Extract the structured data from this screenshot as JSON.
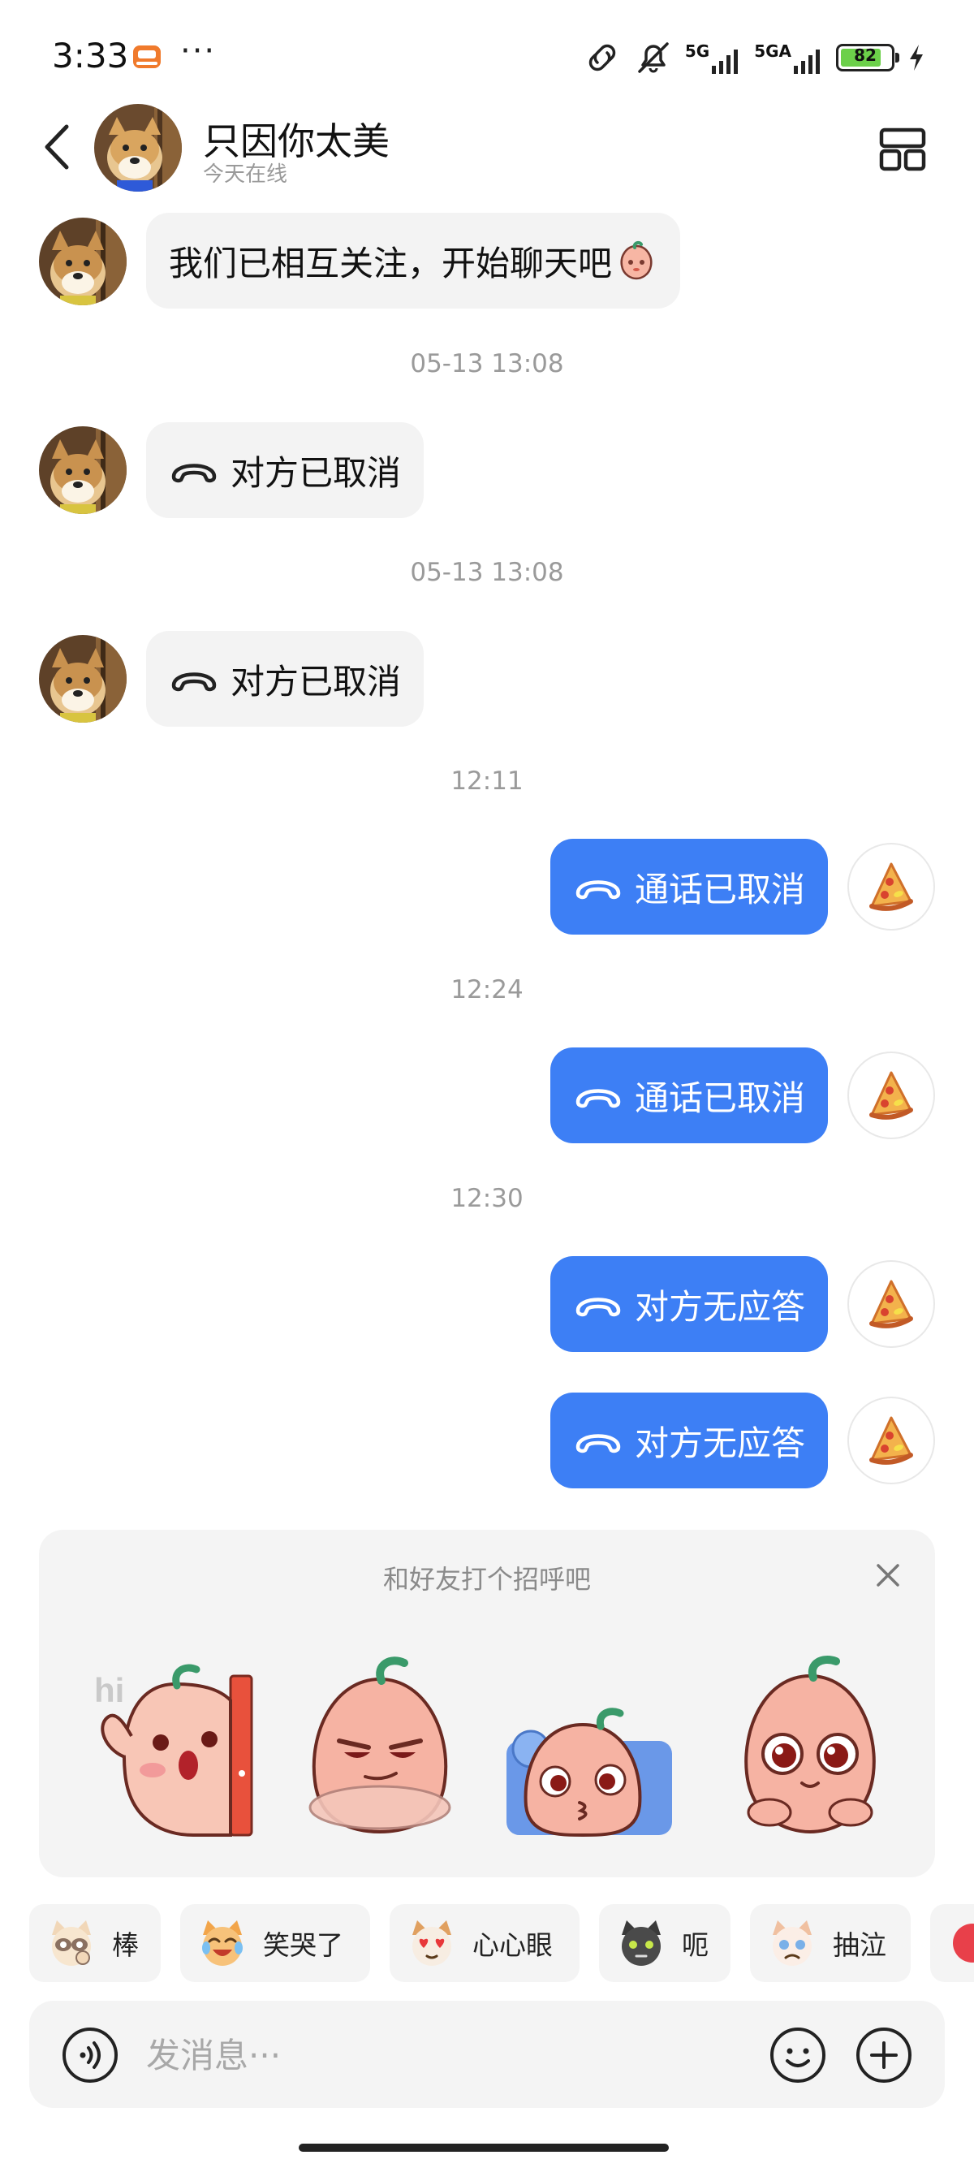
{
  "status_bar": {
    "time": "3:33",
    "dots": "···",
    "net_1": "5G",
    "net_2": "5GA",
    "battery": "82",
    "battery_level_percent": 82,
    "battery_color": "#6cd04a"
  },
  "header": {
    "name": "只因你太美",
    "status": "今天在线"
  },
  "messages": [
    {
      "type": "received",
      "text": "我们已相互关注，开始聊天吧",
      "emoji": "peach-emoji"
    },
    {
      "type": "timestamp",
      "text": "05-13 13:08"
    },
    {
      "type": "received",
      "text": "对方已取消",
      "icon": "phone-hangup-icon"
    },
    {
      "type": "timestamp",
      "text": "05-13 13:08"
    },
    {
      "type": "received",
      "text": "对方已取消",
      "icon": "phone-hangup-icon"
    },
    {
      "type": "timestamp",
      "text": "12:11"
    },
    {
      "type": "sent",
      "text": "通话已取消",
      "icon": "phone-hangup-icon"
    },
    {
      "type": "timestamp",
      "text": "12:24"
    },
    {
      "type": "sent",
      "text": "通话已取消",
      "icon": "phone-hangup-icon"
    },
    {
      "type": "timestamp",
      "text": "12:30"
    },
    {
      "type": "sent",
      "text": "对方无应答",
      "icon": "phone-hangup-icon"
    },
    {
      "type": "sent",
      "text": "对方无应答",
      "icon": "phone-hangup-icon"
    }
  ],
  "greeting": {
    "title": "和好友打个招呼吧",
    "sticker_hi_text": "hi",
    "stickers": [
      "peach-hi-sticker",
      "peach-smug-sticker",
      "peach-kiss-sticker",
      "peach-cute-sticker"
    ]
  },
  "quick_replies": [
    {
      "label": "棒",
      "icon": "raccoon-emoji"
    },
    {
      "label": "笑哭了",
      "icon": "cat-laughing-emoji"
    },
    {
      "label": "心心眼",
      "icon": "cat-heart-eyes-emoji"
    },
    {
      "label": "呃",
      "icon": "black-cat-emoji"
    },
    {
      "label": "抽泣",
      "icon": "cat-crying-emoji"
    }
  ],
  "input": {
    "placeholder": "发消息···"
  },
  "colors": {
    "accent": "#3d7ff5",
    "bubble_in": "#f3f3f3",
    "timestamp": "#9a9a9a"
  }
}
